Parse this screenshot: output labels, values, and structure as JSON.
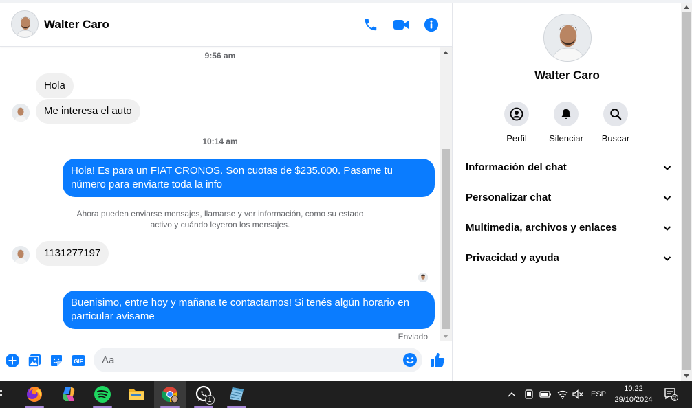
{
  "contact": {
    "name": "Walter Caro"
  },
  "header": {
    "call_icon": "phone-icon",
    "video_icon": "video-icon",
    "info_icon": "info-icon"
  },
  "messages": {
    "timestamp_1": "9:56 am",
    "msg_1": "Hola",
    "msg_2": "Me interesa el auto",
    "timestamp_2": "10:14 am",
    "msg_3": "Hola! Es para un FIAT CRONOS. Son cuotas de $235.000. Pasame tu número para enviarte toda la info",
    "system_note": "Ahora pueden enviarse mensajes, llamarse y ver información, como su estado activo y cuándo leyeron los mensajes.",
    "msg_4": "1131277197",
    "msg_5": "Buenisimo, entre hoy y mañana te contactamos! Si tenés algún horario en particular avisame",
    "status": "Enviado"
  },
  "composer": {
    "placeholder": "Aa"
  },
  "info_panel": {
    "name": "Walter Caro",
    "actions": {
      "profile": "Perfil",
      "mute": "Silenciar",
      "search": "Buscar"
    },
    "sections": {
      "chat_info": "Información del chat",
      "customize": "Personalizar chat",
      "media": "Multimedia, archivos y enlaces",
      "privacy": "Privacidad y ayuda"
    }
  },
  "taskbar": {
    "language": "ESP",
    "time": "10:22",
    "date": "29/10/2024",
    "whatsapp_badge": "1",
    "notification_count": "2"
  },
  "colors": {
    "accent": "#0a7cff",
    "incoming_bubble": "#f0f0f0",
    "taskbar": "#1f1f1f"
  }
}
